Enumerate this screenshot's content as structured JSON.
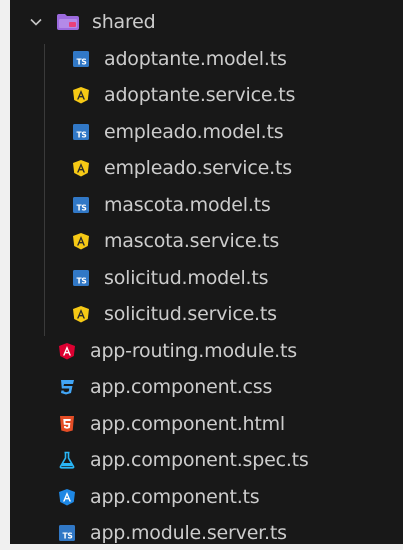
{
  "explorer": {
    "folder": {
      "name": "shared",
      "expanded": true,
      "icon": "folder-shared-icon"
    },
    "children": [
      {
        "name": "adoptante.model.ts",
        "icon": "typescript-icon"
      },
      {
        "name": "adoptante.service.ts",
        "icon": "angular-service-icon"
      },
      {
        "name": "empleado.model.ts",
        "icon": "typescript-icon"
      },
      {
        "name": "empleado.service.ts",
        "icon": "angular-service-icon"
      },
      {
        "name": "mascota.model.ts",
        "icon": "typescript-icon"
      },
      {
        "name": "mascota.service.ts",
        "icon": "angular-service-icon"
      },
      {
        "name": "solicitud.model.ts",
        "icon": "typescript-icon"
      },
      {
        "name": "solicitud.service.ts",
        "icon": "angular-service-icon"
      }
    ],
    "files": [
      {
        "name": "app-routing.module.ts",
        "icon": "angular-routing-icon"
      },
      {
        "name": "app.component.css",
        "icon": "css-icon"
      },
      {
        "name": "app.component.html",
        "icon": "html-icon"
      },
      {
        "name": "app.component.spec.ts",
        "icon": "test-flask-icon"
      },
      {
        "name": "app.component.ts",
        "icon": "angular-component-icon"
      },
      {
        "name": "app.module.server.ts",
        "icon": "typescript-icon"
      }
    ]
  },
  "colors": {
    "background": "#181818",
    "text": "#cccccc",
    "typescript": "#3178c6",
    "angular_yellow": "#f6c915",
    "angular_red": "#dd0031",
    "css": "#42a5f5",
    "html": "#e44d26",
    "test": "#29b6f6",
    "folder": "#9c6ade"
  }
}
